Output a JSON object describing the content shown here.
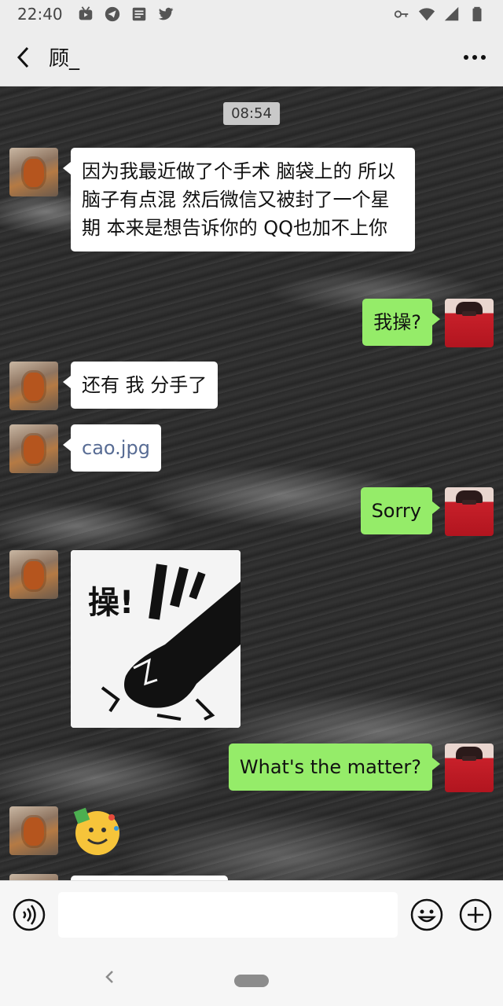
{
  "status_bar": {
    "time": "22:40",
    "notification_icons": [
      "bilibili-icon",
      "telegram-icon",
      "news-icon",
      "twitter-icon"
    ],
    "system_icons": [
      "key-icon",
      "wifi-icon",
      "signal-icon",
      "battery-icon"
    ]
  },
  "header": {
    "title": "顾_",
    "back_icon": "chevron-left-icon",
    "more_icon": "more-dots-icon"
  },
  "chat": {
    "timestamp": "08:54",
    "messages": [
      {
        "from": "contact",
        "type": "text",
        "text": "因为我最近做了个手术 脑袋上的 所以脑子有点混 然后微信又被封了一个星期 本来是想告诉你的 QQ也加不上你"
      },
      {
        "from": "me",
        "type": "text",
        "text": "我操?"
      },
      {
        "from": "contact",
        "type": "text",
        "text": "还有 我 分手了"
      },
      {
        "from": "contact",
        "type": "link",
        "text": "cao.jpg"
      },
      {
        "from": "me",
        "type": "text",
        "text": "Sorry"
      },
      {
        "from": "contact",
        "type": "sticker",
        "sticker_text": "操!"
      },
      {
        "from": "me",
        "type": "text",
        "text": "What's the matter?"
      },
      {
        "from": "contact",
        "type": "emoji",
        "emoji": "party-popper-emoji"
      }
    ]
  },
  "input_bar": {
    "voice_icon": "voice-icon",
    "input_value": "",
    "emoji_icon": "emoji-icon",
    "plus_icon": "plus-icon"
  },
  "colors": {
    "bubble_me": "#95ec69",
    "bubble_contact": "#ffffff",
    "link": "#586c94",
    "header_bg": "#ededed"
  }
}
